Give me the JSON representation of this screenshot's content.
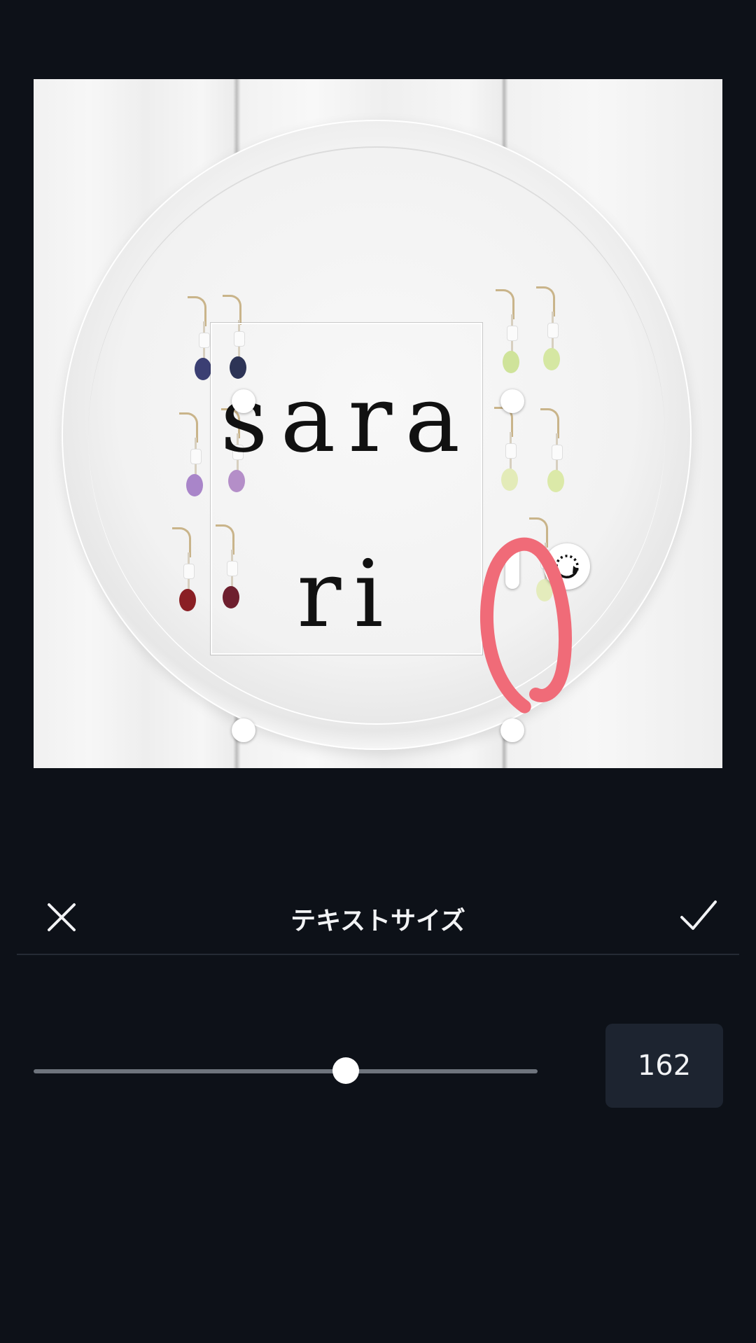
{
  "canvas": {
    "text_lines": [
      "sara",
      "ri"
    ]
  },
  "panel": {
    "title": "テキストサイズ",
    "close_icon": "close-icon",
    "confirm_icon": "checkmark-icon",
    "size_value": "162",
    "slider_level": 0.62
  },
  "colors": {
    "background": "#0d1118",
    "annotation": "#f06b78",
    "value_box": "#1d2430"
  }
}
